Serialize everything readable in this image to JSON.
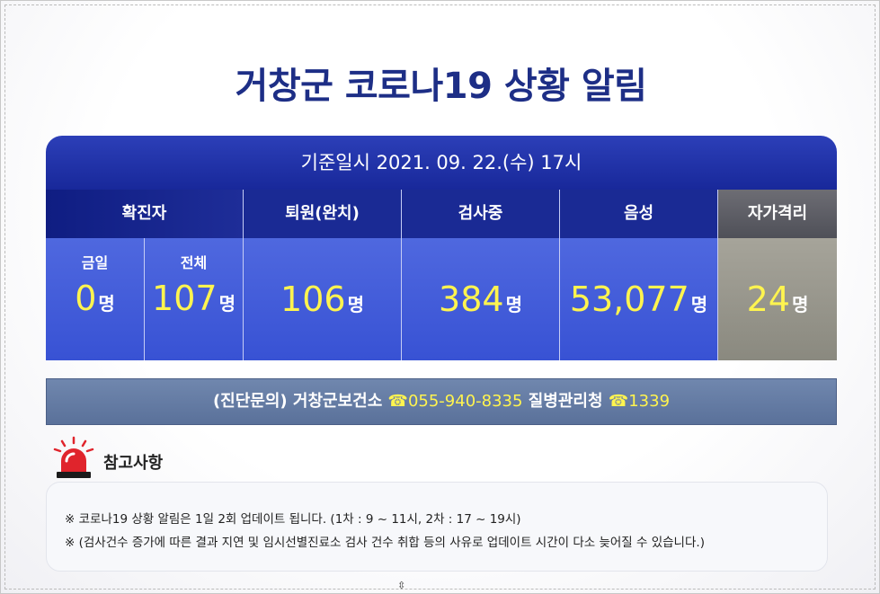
{
  "title": "거창군 코로나19 상황 알림",
  "board": {
    "header": "기준일시 2021. 09. 22.(수) 17시",
    "confirmed": {
      "label": "확진자",
      "today_label": "금일",
      "today_value": "0",
      "total_label": "전체",
      "total_value": "107",
      "unit": "명"
    },
    "discharged": {
      "label": "퇴원(완치)",
      "value": "106",
      "unit": "명"
    },
    "testing": {
      "label": "검사중",
      "value": "384",
      "unit": "명"
    },
    "negative": {
      "label": "음성",
      "value": "53,077",
      "unit": "명"
    },
    "quarantine": {
      "label": "자가격리",
      "value": "24",
      "unit": "명"
    }
  },
  "contact": {
    "prefix": "(진단문의) 거창군보건소 ",
    "phone1": "☎055-940-8335",
    "middle": " 질병관리청 ",
    "phone2": "☎1339"
  },
  "notes": {
    "label": "참고사항",
    "icon": "siren-icon",
    "items": [
      "※ 코로나19 상황 알림은 1일 2회 업데이트 됩니다. (1차 : 9 ~ 11시, 2차 : 17 ~ 19시)",
      "※ (검사건수 증가에 따른 결과 지연 및 임시선별진료소 검사 건수 취합 등의 사유로 업데이트 시간이 다소 늦어질 수 있습니다.)"
    ]
  },
  "colors": {
    "title": "#1d2e86",
    "header_bg": "#18289a",
    "value_yellow": "#fff44f",
    "quarantine_bg": "#8a897f"
  }
}
